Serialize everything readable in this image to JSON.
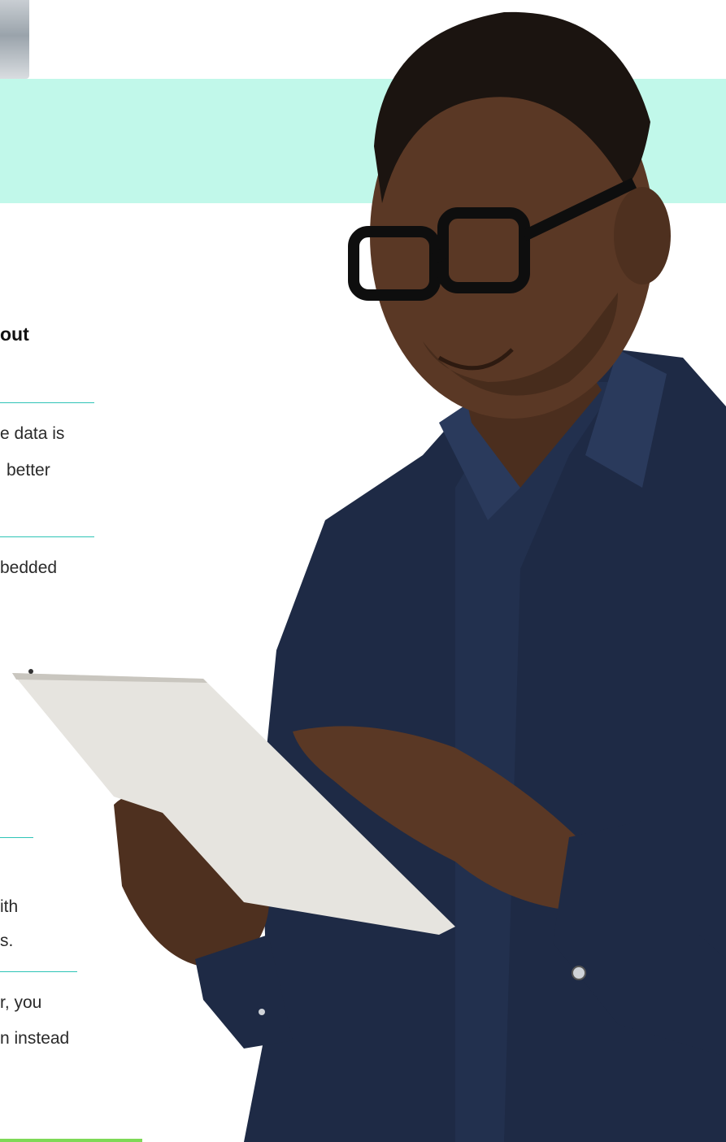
{
  "heading": "out",
  "paragraphs": {
    "p1_line1": "e data is",
    "p1_line2": "better",
    "p2_line1": "bedded",
    "p3_line1": "ith",
    "p3_line2": "s.",
    "p4_line1": "r, you",
    "p4_line2": "n instead"
  },
  "colors": {
    "band": "#c1f8ea",
    "rule": "#2ec4b6",
    "shirt": "#1e2a45",
    "tablet": "#e6e4df",
    "skin": "#5a3825"
  }
}
